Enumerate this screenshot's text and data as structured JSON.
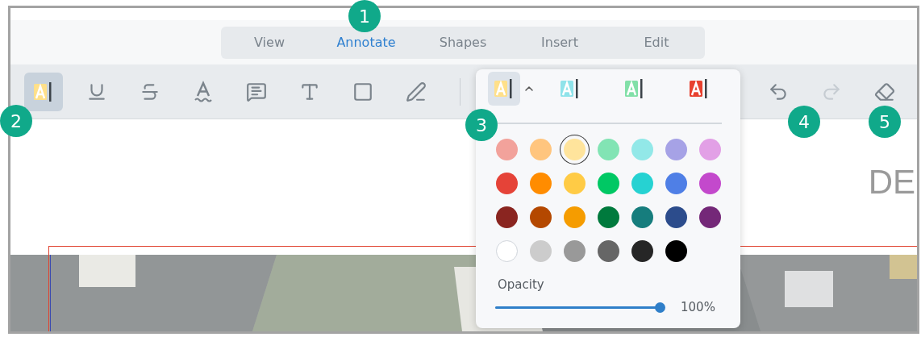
{
  "nav_tabs": [
    {
      "label": "View",
      "selected": false
    },
    {
      "label": "Annotate",
      "selected": true
    },
    {
      "label": "Shapes",
      "selected": false
    },
    {
      "label": "Insert",
      "selected": false
    },
    {
      "label": "Edit",
      "selected": false
    }
  ],
  "toolbar": {
    "tools": [
      {
        "kind": "highlight",
        "selected": true
      },
      {
        "kind": "underline",
        "selected": false
      },
      {
        "kind": "strikeout",
        "selected": false
      },
      {
        "kind": "squiggly",
        "selected": false
      },
      {
        "kind": "note",
        "selected": false
      },
      {
        "kind": "text",
        "selected": false
      },
      {
        "kind": "rectangle",
        "selected": false
      },
      {
        "kind": "ink",
        "selected": false
      }
    ],
    "actions": [
      {
        "kind": "undo",
        "disabled": false
      },
      {
        "kind": "redo",
        "disabled": true
      },
      {
        "kind": "eraser",
        "disabled": false
      }
    ]
  },
  "style_popup": {
    "presets": [
      {
        "color": "#ffe08a",
        "selected": true
      },
      {
        "color": "#8fe3ea",
        "selected": false
      },
      {
        "color": "#82e0a8",
        "selected": false
      },
      {
        "color": "#e8412f",
        "selected": false
      }
    ],
    "palette": [
      {
        "color": "#f2a29b",
        "selected": false
      },
      {
        "color": "#ffc57e",
        "selected": false
      },
      {
        "color": "#ffe49c",
        "selected": true
      },
      {
        "color": "#82e4b4",
        "selected": false
      },
      {
        "color": "#92e8e8",
        "selected": false
      },
      {
        "color": "#a6a2e6",
        "selected": false
      },
      {
        "color": "#e2a0e6",
        "selected": false
      },
      {
        "color": "#e54338",
        "selected": false
      },
      {
        "color": "#ff8c00",
        "selected": false
      },
      {
        "color": "#ffcb45",
        "selected": false
      },
      {
        "color": "#00c864",
        "selected": false
      },
      {
        "color": "#26d2d2",
        "selected": false
      },
      {
        "color": "#4f7fe6",
        "selected": false
      },
      {
        "color": "#c349cc",
        "selected": false
      },
      {
        "color": "#8a2520",
        "selected": false
      },
      {
        "color": "#b44800",
        "selected": false
      },
      {
        "color": "#f59c00",
        "selected": false
      },
      {
        "color": "#007a3d",
        "selected": false
      },
      {
        "color": "#167d7d",
        "selected": false
      },
      {
        "color": "#2c4c8c",
        "selected": false
      },
      {
        "color": "#742878",
        "selected": false
      },
      {
        "color": "#ffffff",
        "selected": false
      },
      {
        "color": "#cccccc",
        "selected": false
      },
      {
        "color": "#999999",
        "selected": false
      },
      {
        "color": "#666666",
        "selected": false
      },
      {
        "color": "#262626",
        "selected": false
      },
      {
        "color": "#000000",
        "selected": false
      }
    ],
    "opacity": {
      "label": "Opacity",
      "level": 1,
      "reading": "100%"
    }
  },
  "document": {
    "heading": "DE"
  },
  "callouts": [
    "1",
    "2",
    "3",
    "4",
    "5"
  ]
}
